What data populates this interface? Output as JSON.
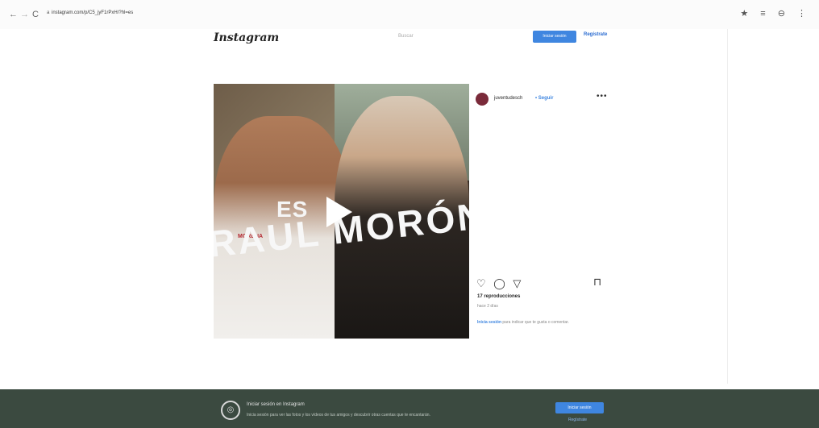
{
  "browser": {
    "back": "←",
    "forward": "→",
    "reload": "C",
    "lock": "a",
    "url": "instagram.com/p/C5_jyF1rPxH/?hl=es",
    "tools": "★ ≡ ⊖ ⋮"
  },
  "ig": {
    "logo": "Instagram",
    "search_placeholder": "Buscar",
    "login_label": "Iniciar sesión",
    "register_label": "Regístrate"
  },
  "post": {
    "overlay_es": "ES",
    "overlay_name": "RAUL MORÓN",
    "party_tag": "MORENA",
    "username": "juventudesch",
    "follow": "• Seguir",
    "more": "•••",
    "actions": "♡ ◯ ▽",
    "save": "⊓",
    "views": "17 reproducciones",
    "date": "hace 2 días",
    "login_prompt_link": "Inicia sesión",
    "login_prompt_text": " para indicar que te gusta o comentar."
  },
  "banner": {
    "icon": "◎",
    "title": "Iniciar sesión en Instagram",
    "subtitle": "Inicia sesión para ver las fotos y los vídeos de tus amigos y descubrir otras cuentas que te encantarán.",
    "button": "Iniciar sesión",
    "link": "Regístrate"
  }
}
